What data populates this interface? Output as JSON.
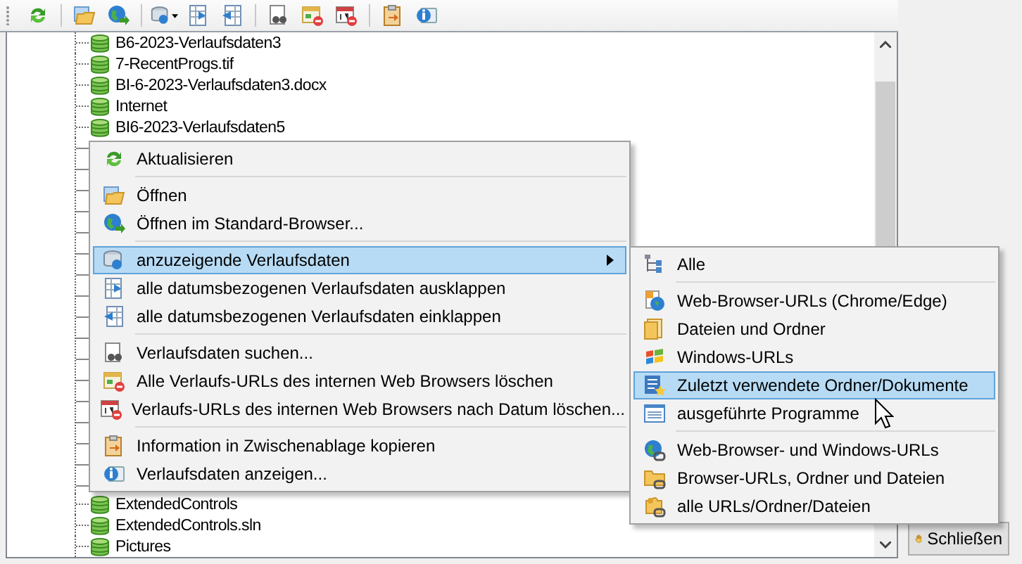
{
  "tree": {
    "items_above_menu": [
      {
        "label": "B6-2023-Verlaufsdaten3"
      },
      {
        "label": "7-RecentProgs.tif"
      },
      {
        "label": "BI-6-2023-Verlaufsdaten3.docx"
      },
      {
        "label": "Internet"
      },
      {
        "label": "BI6-2023-Verlaufsdaten5"
      }
    ],
    "items_below_menu": [
      {
        "label": "ExtendedControls"
      },
      {
        "label": "ExtendedControls.sln"
      },
      {
        "label": "Pictures"
      }
    ]
  },
  "context_menu": {
    "groups": [
      [
        {
          "label": "Aktualisieren",
          "selected": false,
          "has_submenu": false
        }
      ],
      [
        {
          "label": "Öffnen",
          "selected": false,
          "has_submenu": false
        },
        {
          "label": "Öffnen im Standard-Browser...",
          "selected": false,
          "has_submenu": false
        }
      ],
      [
        {
          "label": "anzuzeigende Verlaufsdaten",
          "selected": true,
          "has_submenu": true
        },
        {
          "label": "alle datumsbezogenen Verlaufsdaten ausklappen",
          "selected": false,
          "has_submenu": false
        },
        {
          "label": "alle datumsbezogenen Verlaufsdaten einklappen",
          "selected": false,
          "has_submenu": false
        }
      ],
      [
        {
          "label": "Verlaufsdaten suchen...",
          "selected": false,
          "has_submenu": false
        },
        {
          "label": "Alle Verlaufs-URLs des internen Web Browsers löschen",
          "selected": false,
          "has_submenu": false
        },
        {
          "label": "Verlaufs-URLs des internen Web Browsers nach Datum löschen...",
          "selected": false,
          "has_submenu": false
        }
      ],
      [
        {
          "label": "Information in Zwischenablage kopieren",
          "selected": false,
          "has_submenu": false
        },
        {
          "label": "Verlaufsdaten anzeigen...",
          "selected": false,
          "has_submenu": false
        }
      ]
    ]
  },
  "submenu": {
    "groups": [
      [
        {
          "label": "Alle",
          "selected": false
        }
      ],
      [
        {
          "label": "Web-Browser-URLs (Chrome/Edge)",
          "selected": false
        },
        {
          "label": "Dateien und Ordner",
          "selected": false
        },
        {
          "label": "Windows-URLs",
          "selected": false
        },
        {
          "label": "Zuletzt verwendete Ordner/Dokumente",
          "selected": true
        },
        {
          "label": "ausgeführte Programme",
          "selected": false
        }
      ],
      [
        {
          "label": "Web-Browser- und Windows-URLs",
          "selected": false
        },
        {
          "label": "Browser-URLs, Ordner und Dateien",
          "selected": false
        },
        {
          "label": "alle URLs/Ordner/Dateien",
          "selected": false
        }
      ]
    ]
  },
  "close_button": {
    "label": "Schließen"
  }
}
